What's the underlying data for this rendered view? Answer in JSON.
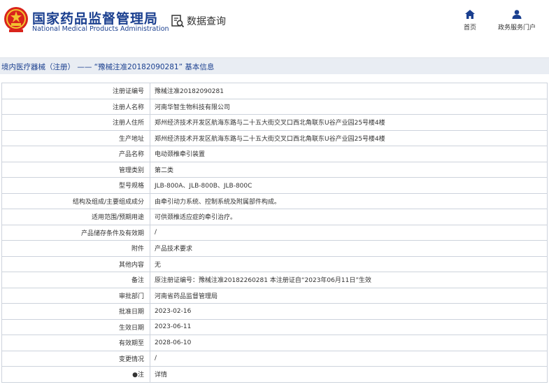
{
  "header": {
    "brand_cn": "国家药品监督管理局",
    "brand_en": "National Medical Products Administration",
    "query_label": "数据查询",
    "nav": {
      "home": "首页",
      "gov": "政务服务门户"
    }
  },
  "breadcrumb": "境内医疗器械（注册） —— “豫械注准20182090281” 基本信息",
  "rows": [
    {
      "label": "注册证编号",
      "value": "豫械注准20182090281"
    },
    {
      "label": "注册人名称",
      "value": "河南华智生物科技有限公司"
    },
    {
      "label": "注册人住所",
      "value": "郑州经济技术开发区航海东路与二十五大街交叉口西北角联东U谷产业园25号楼4楼"
    },
    {
      "label": "生产地址",
      "value": "郑州经济技术开发区航海东路与二十五大街交叉口西北角联东U谷产业园25号楼4楼"
    },
    {
      "label": "产品名称",
      "value": "电动颈椎牵引装置"
    },
    {
      "label": "管理类别",
      "value": "第二类"
    },
    {
      "label": "型号规格",
      "value": "JLB-800A、JLB-800B、JLB-800C"
    },
    {
      "label": "结构及组成/主要组成成分",
      "value": "由牵引动力系统、控制系统及附属部件构成。"
    },
    {
      "label": "适用范围/预期用途",
      "value": "可供颈椎适应症的牵引治疗。"
    },
    {
      "label": "产品储存条件及有效期",
      "value": "/"
    },
    {
      "label": "附件",
      "value": "产品技术要求"
    },
    {
      "label": "其他内容",
      "value": "无"
    },
    {
      "label": "备注",
      "value": "原注册证编号：豫械注准20182260281 本注册证自“2023年06月11日”生效"
    },
    {
      "label": "审批部门",
      "value": "河南省药品监督管理局"
    },
    {
      "label": "批准日期",
      "value": "2023-02-16"
    },
    {
      "label": "生效日期",
      "value": "2023-06-11"
    },
    {
      "label": "有效期至",
      "value": "2028-06-10"
    },
    {
      "label": "变更情况",
      "value": "/"
    },
    {
      "label": "●注",
      "value": "详情"
    }
  ]
}
